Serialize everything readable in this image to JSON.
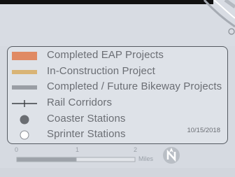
{
  "legend": {
    "items": [
      {
        "label": "Completed EAP Projects",
        "symbol": "swatch",
        "color": "#e08a63"
      },
      {
        "label": "In-Construction Project",
        "symbol": "line-thick",
        "color": "#d9b476"
      },
      {
        "label": "Completed / Future Bikeway Projects",
        "symbol": "line-thick",
        "color": "#9a9ea5"
      },
      {
        "label": "Rail Corridors",
        "symbol": "rail",
        "color": "#3c3f44"
      },
      {
        "label": "Coaster Stations",
        "symbol": "dot-filled",
        "color": "#6a6d72"
      },
      {
        "label": "Sprinter Stations",
        "symbol": "dot-hollow",
        "color": "#ffffff"
      }
    ],
    "date": "10/15/2018"
  },
  "scale": {
    "ticks": [
      "0",
      "1",
      "2"
    ],
    "unit": "Miles"
  },
  "icons": {
    "north_arrow": "north-arrow-icon"
  },
  "colors": {
    "map_background": "#d6dae1",
    "legend_border": "#555a61",
    "legend_text": "#6b6e74"
  }
}
